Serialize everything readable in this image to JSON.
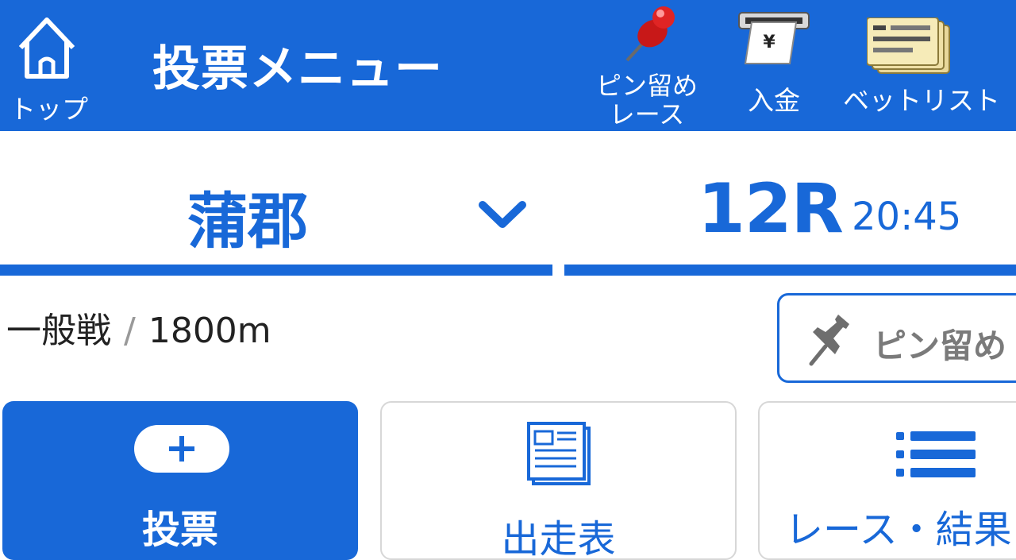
{
  "header": {
    "home_label": "トップ",
    "title": "投票メニュー",
    "pin_label_line1": "ピン留め",
    "pin_label_line2": "レース",
    "deposit_label": "入金",
    "betlist_label": "ベットリスト",
    "icons": {
      "home": "home-icon",
      "pin": "red-pushpin-icon",
      "deposit": "atm-yen-icon",
      "betlist": "betting-tickets-icon"
    }
  },
  "selector": {
    "venue": "蒲郡",
    "race_number": "12R",
    "race_time": "20:45"
  },
  "race_info": {
    "type": "一般戦",
    "separator": "/",
    "distance": "1800m"
  },
  "pin_button": {
    "label": "ピン留め"
  },
  "menu_cards": [
    {
      "label": "投票",
      "icon": "plus-icon"
    },
    {
      "label": "出走表",
      "icon": "newspaper-icon"
    },
    {
      "label": "レース・結果",
      "icon": "list-icon"
    }
  ],
  "colors": {
    "primary": "#1868d8",
    "card_border": "#d7d7d7",
    "muted_text": "#7a7a7a"
  }
}
